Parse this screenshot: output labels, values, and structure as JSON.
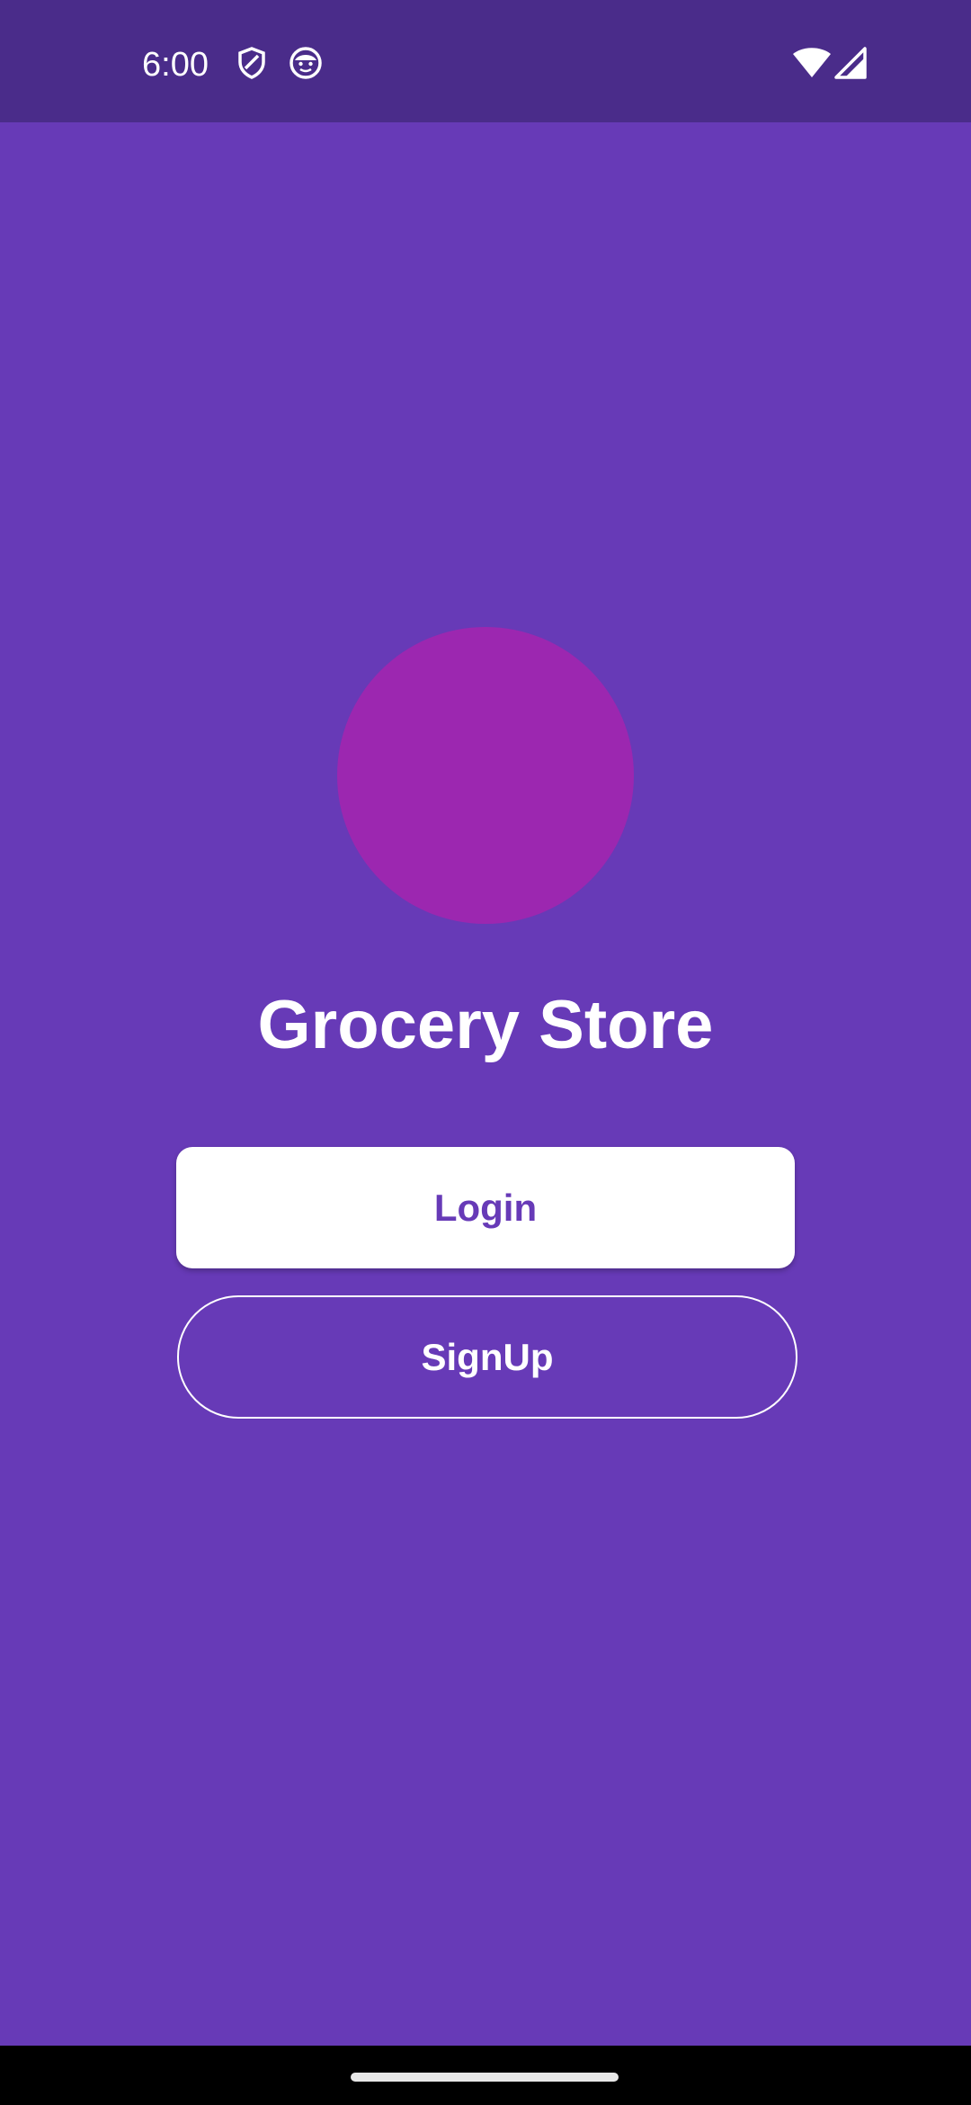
{
  "status_bar": {
    "time": "6:00",
    "left_icons": [
      "shield-icon",
      "emoji-face-icon"
    ],
    "right_icons": [
      "wifi-icon",
      "cell-signal-icon"
    ]
  },
  "app": {
    "title": "Grocery Store",
    "logo": "purple-circle",
    "login_label": "Login",
    "signup_label": "SignUp"
  },
  "colors": {
    "background": "#673AB7",
    "status_bar": "#4A2C8A",
    "logo_circle": "#9C27B0",
    "login_button_bg": "#FFFFFF",
    "login_text": "#673AB7",
    "signup_border": "#FFFFFF",
    "signup_text": "#FFFFFF"
  }
}
